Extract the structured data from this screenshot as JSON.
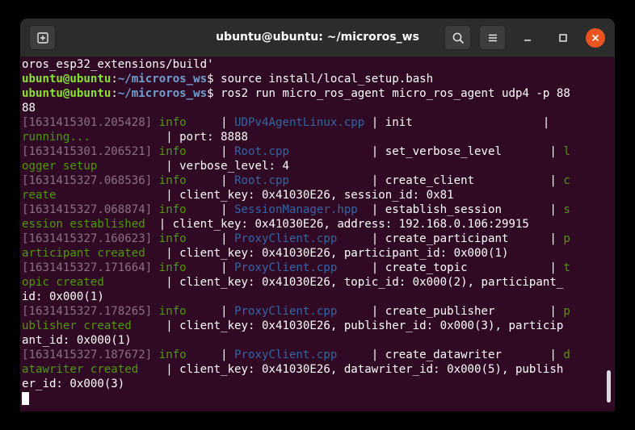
{
  "window": {
    "title": "ubuntu@ubuntu: ~/microros_ws"
  },
  "titlebar_icons": {
    "new_tab": "new-tab-icon",
    "search": "search-icon",
    "menu": "hamburger-menu-icon",
    "minimize": "minimize-icon",
    "maximize": "maximize-icon",
    "close": "close-icon"
  },
  "colors": {
    "terminal_bg": "#300a24",
    "titlebar_bg": "#2c2c2c",
    "prompt_user": "#8ae234",
    "prompt_path": "#729fcf",
    "info": "#4e9a06",
    "file": "#3465a4",
    "timestamp": "#8b6f86",
    "close_button": "#e95420"
  },
  "terminal": {
    "lines": [
      {
        "type": "plain",
        "text": "oros_esp32_extensions/build'"
      },
      {
        "type": "prompt",
        "user": "ubuntu@ubuntu",
        "sep": ":",
        "path": "~/microros_ws",
        "dollar": "$ ",
        "cmd": "source install/local_setup.bash"
      },
      {
        "type": "prompt",
        "user": "ubuntu@ubuntu",
        "sep": ":",
        "path": "~/microros_ws",
        "dollar": "$ ",
        "cmd": "ros2 run micro_ros_agent micro_ros_agent udp4 -p 88"
      },
      {
        "type": "plain",
        "text": "88"
      },
      {
        "type": "log",
        "ts": "[1631415301.205428]",
        "level": " info     ",
        "p1": "| ",
        "file": "UDPv4AgentLinux.cpp",
        "p2": " | init                   |"
      },
      {
        "type": "segs",
        "segs": [
          {
            "c": "msg",
            "t": "running...           "
          },
          {
            "c": "plain",
            "t": "| port: 8888"
          }
        ]
      },
      {
        "type": "log",
        "ts": "[1631415301.206521]",
        "level": " info     ",
        "p1": "| ",
        "file": "Root.cpp",
        "p2": "            | set_verbose_level       | ",
        "tail": "l"
      },
      {
        "type": "segs",
        "segs": [
          {
            "c": "msg",
            "t": "ogger setup          "
          },
          {
            "c": "plain",
            "t": "| verbose_level: 4"
          }
        ]
      },
      {
        "type": "log",
        "ts": "[1631415327.068536]",
        "level": " info     ",
        "p1": "| ",
        "file": "Root.cpp",
        "p2": "            | create_client           | ",
        "tail": "c"
      },
      {
        "type": "segs",
        "segs": [
          {
            "c": "msg",
            "t": "reate                "
          },
          {
            "c": "plain",
            "t": "| client_key: 0x41030E26, session_id: 0x81"
          }
        ]
      },
      {
        "type": "log",
        "ts": "[1631415327.068874]",
        "level": " info     ",
        "p1": "| ",
        "file": "SessionManager.hpp",
        "p2": "  | establish_session       | ",
        "tail": "s"
      },
      {
        "type": "segs",
        "segs": [
          {
            "c": "msg",
            "t": "ession established  "
          },
          {
            "c": "plain",
            "t": "| client_key: 0x41030E26, address: 192.168.0.106:29915"
          }
        ]
      },
      {
        "type": "log",
        "ts": "[1631415327.160623]",
        "level": " info     ",
        "p1": "| ",
        "file": "ProxyClient.cpp",
        "p2": "     | create_participant      | ",
        "tail": "p"
      },
      {
        "type": "segs",
        "segs": [
          {
            "c": "msg",
            "t": "articipant created   "
          },
          {
            "c": "plain",
            "t": "| client_key: 0x41030E26, participant_id: 0x000(1)"
          }
        ]
      },
      {
        "type": "log",
        "ts": "[1631415327.171664]",
        "level": " info     ",
        "p1": "| ",
        "file": "ProxyClient.cpp",
        "p2": "     | create_topic            | ",
        "tail": "t"
      },
      {
        "type": "segs",
        "segs": [
          {
            "c": "msg",
            "t": "opic created         "
          },
          {
            "c": "plain",
            "t": "| client_key: 0x41030E26, topic_id: 0x000(2), participant_"
          }
        ]
      },
      {
        "type": "plain",
        "text": "id: 0x000(1)"
      },
      {
        "type": "log",
        "ts": "[1631415327.178265]",
        "level": " info     ",
        "p1": "| ",
        "file": "ProxyClient.cpp",
        "p2": "     | create_publisher        | ",
        "tail": "p"
      },
      {
        "type": "segs",
        "segs": [
          {
            "c": "msg",
            "t": "ublisher created     "
          },
          {
            "c": "plain",
            "t": "| client_key: 0x41030E26, publisher_id: 0x000(3), particip"
          }
        ]
      },
      {
        "type": "plain",
        "text": "ant_id: 0x000(1)"
      },
      {
        "type": "log",
        "ts": "[1631415327.187672]",
        "level": " info     ",
        "p1": "| ",
        "file": "ProxyClient.cpp",
        "p2": "     | create_datawriter       | ",
        "tail": "d"
      },
      {
        "type": "segs",
        "segs": [
          {
            "c": "msg",
            "t": "atawriter created    "
          },
          {
            "c": "plain",
            "t": "| client_key: 0x41030E26, datawriter_id: 0x000(5), publish"
          }
        ]
      },
      {
        "type": "plain",
        "text": "er_id: 0x000(3)"
      },
      {
        "type": "cursor"
      }
    ]
  }
}
